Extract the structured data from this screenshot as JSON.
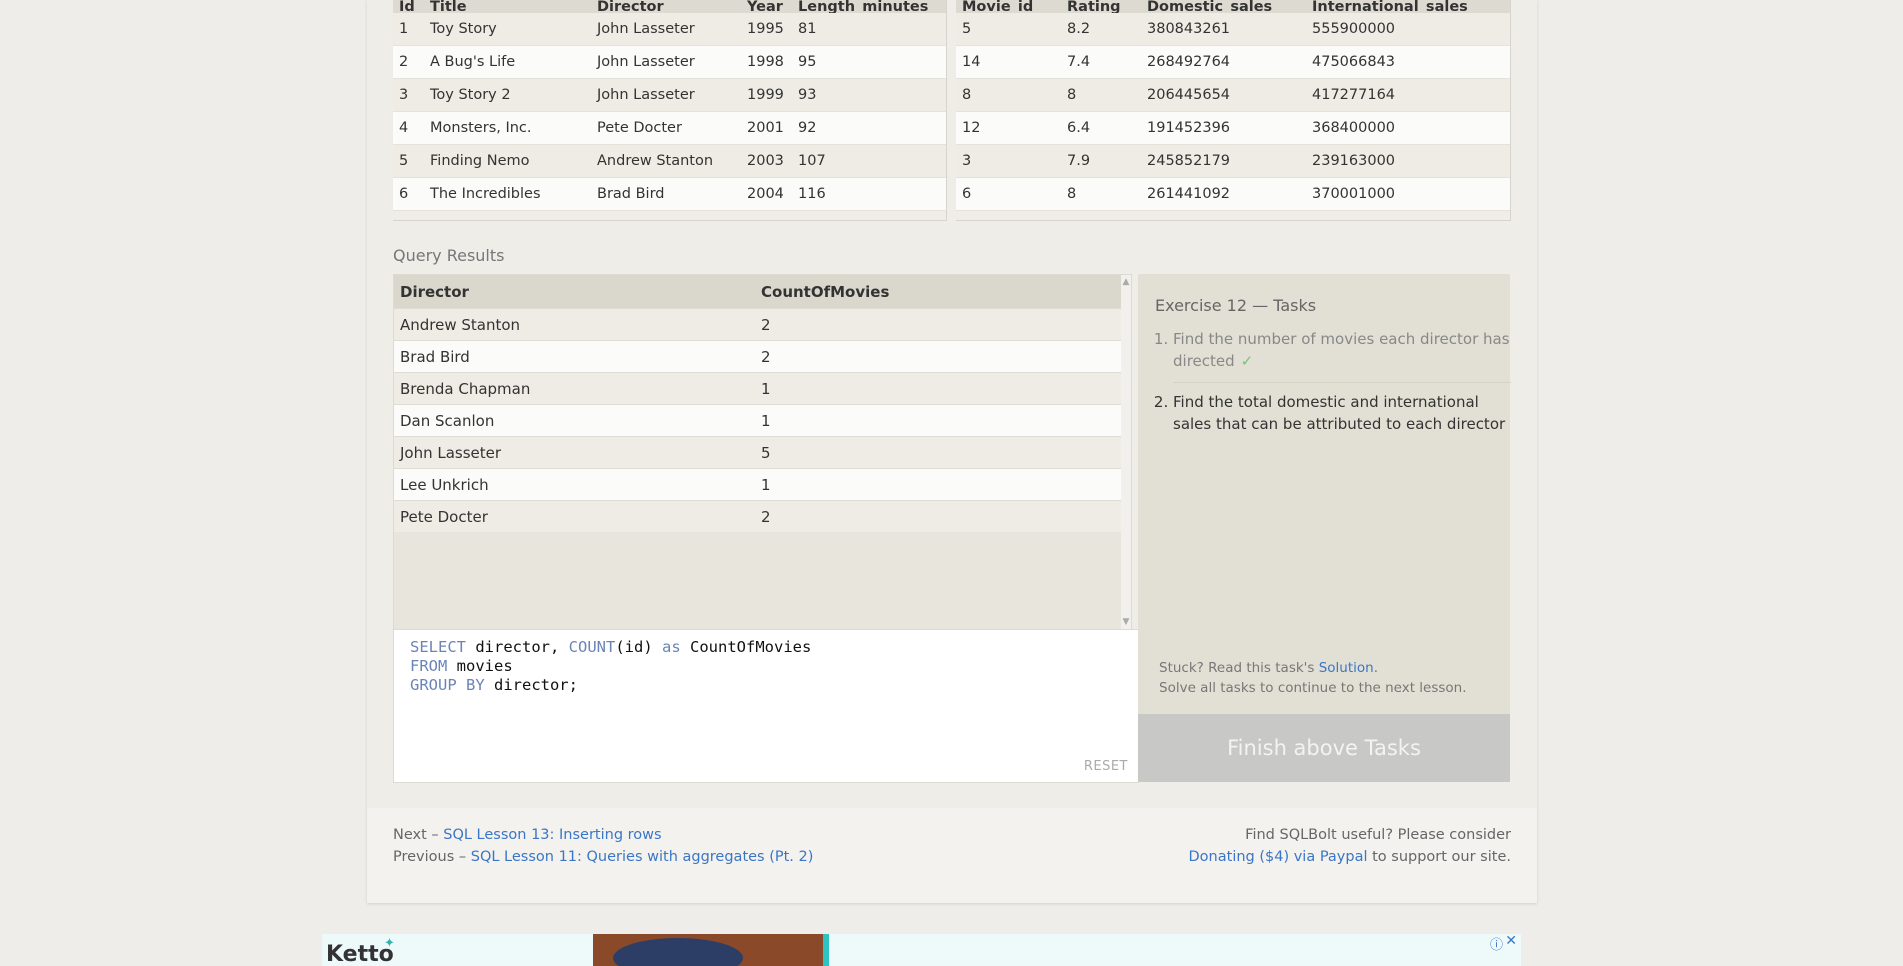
{
  "movies_table": {
    "headers": [
      "Id",
      "Title",
      "Director",
      "Year",
      "Length_minutes"
    ],
    "rows": [
      [
        "1",
        "Toy Story",
        "John Lasseter",
        "1995",
        "81"
      ],
      [
        "2",
        "A Bug's Life",
        "John Lasseter",
        "1998",
        "95"
      ],
      [
        "3",
        "Toy Story 2",
        "John Lasseter",
        "1999",
        "93"
      ],
      [
        "4",
        "Monsters, Inc.",
        "Pete Docter",
        "2001",
        "92"
      ],
      [
        "5",
        "Finding Nemo",
        "Andrew Stanton",
        "2003",
        "107"
      ],
      [
        "6",
        "The Incredibles",
        "Brad Bird",
        "2004",
        "116"
      ]
    ]
  },
  "boxoffice_table": {
    "headers": [
      "Movie_id",
      "Rating",
      "Domestic_sales",
      "International_sales"
    ],
    "rows": [
      [
        "5",
        "8.2",
        "380843261",
        "555900000"
      ],
      [
        "14",
        "7.4",
        "268492764",
        "475066843"
      ],
      [
        "8",
        "8",
        "206445654",
        "417277164"
      ],
      [
        "12",
        "6.4",
        "191452396",
        "368400000"
      ],
      [
        "3",
        "7.9",
        "245852179",
        "239163000"
      ],
      [
        "6",
        "8",
        "261441092",
        "370001000"
      ]
    ]
  },
  "query_results": {
    "label": "Query Results",
    "headers": [
      "Director",
      "CountOfMovies"
    ],
    "rows": [
      [
        "Andrew Stanton",
        "2"
      ],
      [
        "Brad Bird",
        "2"
      ],
      [
        "Brenda Chapman",
        "1"
      ],
      [
        "Dan Scanlon",
        "1"
      ],
      [
        "John Lasseter",
        "5"
      ],
      [
        "Lee Unkrich",
        "1"
      ],
      [
        "Pete Docter",
        "2"
      ]
    ]
  },
  "editor": {
    "line1": {
      "kw1": "SELECT",
      "t1": " director, ",
      "kw2": "COUNT",
      "t2": "(id) ",
      "kw3": "as",
      "t3": " CountOfMovies"
    },
    "line2": {
      "kw1": "FROM",
      "t1": " movies"
    },
    "line3": {
      "kw1": "GROUP BY",
      "t1": " director;"
    },
    "reset_label": "RESET"
  },
  "tasks": {
    "title": "Exercise 12 — Tasks",
    "items": [
      {
        "number": "1.",
        "text": "Find the number of movies each director has directed",
        "done": true,
        "check": "✓"
      },
      {
        "number": "2.",
        "text": "Find the total domestic and international sales that can be attributed to each director",
        "done": false
      }
    ],
    "stuck_prefix": "Stuck? Read this task's ",
    "solution_link": "Solution",
    "stuck_suffix": ".",
    "solve_all": "Solve all tasks to continue to the next lesson.",
    "finish_label": "Finish above Tasks"
  },
  "footer": {
    "next_prefix": "Next – ",
    "next_link": "SQL Lesson 13: Inserting rows",
    "prev_prefix": "Previous – ",
    "prev_link": "SQL Lesson 11: Queries with aggregates (Pt. 2)",
    "useful_text": "Find SQLBolt useful? Please consider",
    "donate_link": "Donating ($4) via Paypal",
    "donate_suffix": " to support our site."
  },
  "ad": {
    "brand": "Ketto",
    "info_icon": "info-icon",
    "close_icon": "close-icon"
  }
}
